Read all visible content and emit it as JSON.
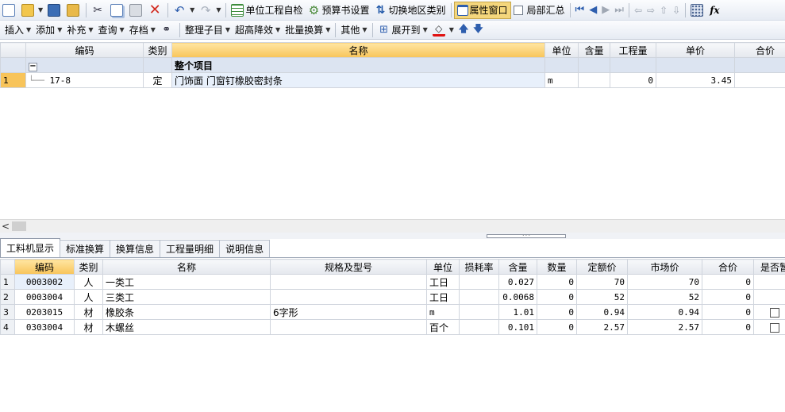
{
  "toolbar1": {
    "self_check": "单位工程自检",
    "budget_settings": "预算书设置",
    "switch_region": "切换地区类别",
    "property_window": "属性窗口",
    "partial_summary": "局部汇总"
  },
  "toolbar2": {
    "insert": "插入",
    "add": "添加",
    "supplement": "补充",
    "query": "查询",
    "archive": "存档",
    "organize_children": "整理子目",
    "height_reduction": "超高降效",
    "batch_convert": "批量换算",
    "other": "其他",
    "expand_to": "展开到"
  },
  "upper_table": {
    "headers": [
      "编码",
      "类别",
      "名称",
      "单位",
      "含量",
      "工程量",
      "单价",
      "合价"
    ],
    "group_row": {
      "name": "整个项目"
    },
    "rows": [
      {
        "num": "1",
        "code": "17-8",
        "type": "定",
        "name": "门饰面 门窗钉橡胶密封条",
        "unit": "m",
        "content": "",
        "quantity": "0",
        "price": "3.45",
        "total": ""
      }
    ]
  },
  "tabs": [
    "工料机显示",
    "标准换算",
    "换算信息",
    "工程量明细",
    "说明信息"
  ],
  "lower_table": {
    "headers": [
      "编码",
      "类别",
      "名称",
      "规格及型号",
      "单位",
      "损耗率",
      "含量",
      "数量",
      "定额价",
      "市场价",
      "合价",
      "是否暂"
    ],
    "rows": [
      {
        "num": "1",
        "code": "0003002",
        "type": "人",
        "name": "一类工",
        "spec": "",
        "unit": "工日",
        "loss": "",
        "content": "0.027",
        "qty": "0",
        "quota": "70",
        "market": "70",
        "total": "0"
      },
      {
        "num": "2",
        "code": "0003004",
        "type": "人",
        "name": "三类工",
        "spec": "",
        "unit": "工日",
        "loss": "",
        "content": "0.0068",
        "qty": "0",
        "quota": "52",
        "market": "52",
        "total": "0"
      },
      {
        "num": "3",
        "code": "0203015",
        "type": "材",
        "name": "橡胶条",
        "spec": "6字形",
        "unit": "m",
        "loss": "",
        "content": "1.01",
        "qty": "0",
        "quota": "0.94",
        "market": "0.94",
        "total": "0"
      },
      {
        "num": "4",
        "code": "0303004",
        "type": "材",
        "name": "木螺丝",
        "spec": "",
        "unit": "百个",
        "loss": "",
        "content": "0.101",
        "qty": "0",
        "quota": "2.57",
        "market": "2.57",
        "total": "0"
      }
    ]
  },
  "colors": {
    "header_highlight": "#f8c45a",
    "group_row": "#dce4f1",
    "toolbar_bg": "#e6ebf3"
  }
}
